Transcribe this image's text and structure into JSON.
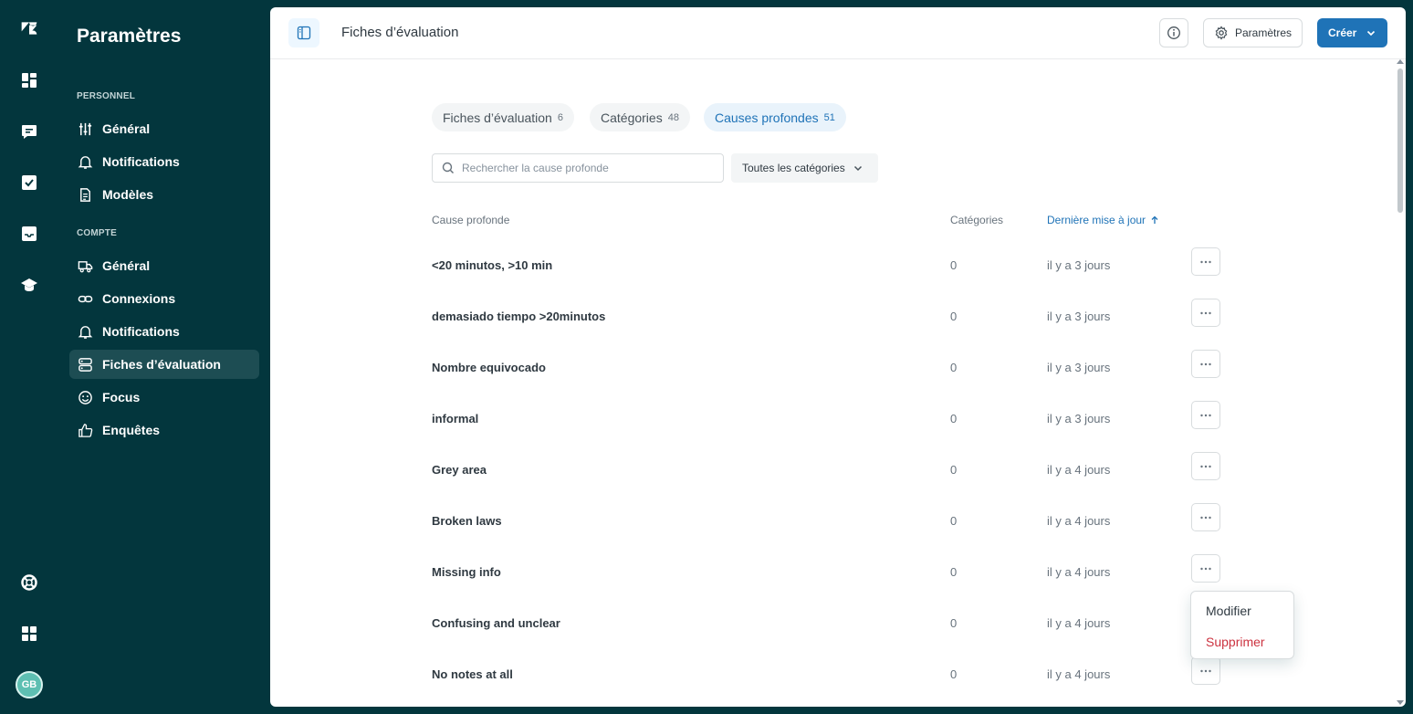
{
  "rail": {
    "icons": [
      "zendesk-logo-icon",
      "dashboard-icon",
      "conversations-icon",
      "reviews-icon",
      "inbox-icon",
      "coaching-icon",
      "help-icon",
      "apps-icon"
    ],
    "avatar_initials": "GB"
  },
  "sidebar": {
    "title": "Paramètres",
    "sections": [
      {
        "label": "PERSONNEL",
        "items": [
          {
            "label": "Général",
            "icon": "sliders-icon"
          },
          {
            "label": "Notifications",
            "icon": "bell-icon"
          },
          {
            "label": "Modèles",
            "icon": "document-icon"
          }
        ]
      },
      {
        "label": "COMPTE",
        "items": [
          {
            "label": "Général",
            "icon": "truck-icon"
          },
          {
            "label": "Connexions",
            "icon": "link-icon"
          },
          {
            "label": "Notifications",
            "icon": "bell-icon"
          },
          {
            "label": "Fiches d’évaluation",
            "icon": "scorecard-icon",
            "active": true
          },
          {
            "label": "Focus",
            "icon": "smiley-icon"
          },
          {
            "label": "Enquêtes",
            "icon": "thumbs-up-icon"
          }
        ]
      }
    ]
  },
  "header": {
    "title": "Fiches d’évaluation",
    "settings_label": "Paramètres",
    "create_label": "Créer"
  },
  "tabs": [
    {
      "label": "Fiches d’évaluation",
      "count": "6"
    },
    {
      "label": "Catégories",
      "count": "48"
    },
    {
      "label": "Causes profondes",
      "count": "51",
      "active": true
    }
  ],
  "search": {
    "placeholder": "Rechercher la cause profonde"
  },
  "filter": {
    "label": "Toutes les catégories"
  },
  "table": {
    "columns": [
      "Cause profonde",
      "Catégories",
      "Dernière mise à jour"
    ],
    "rows": [
      {
        "name": "<20 minutos, >10 min",
        "categories": "0",
        "updated": "il y a 3 jours"
      },
      {
        "name": "demasiado tiempo >20minutos",
        "categories": "0",
        "updated": "il y a 3 jours"
      },
      {
        "name": "Nombre equivocado",
        "categories": "0",
        "updated": "il y a 3 jours"
      },
      {
        "name": "informal",
        "categories": "0",
        "updated": "il y a 3 jours"
      },
      {
        "name": "Grey area",
        "categories": "0",
        "updated": "il y a 4 jours"
      },
      {
        "name": "Broken laws",
        "categories": "0",
        "updated": "il y a 4 jours"
      },
      {
        "name": "Missing info",
        "categories": "0",
        "updated": "il y a 4 jours"
      },
      {
        "name": "Confusing and unclear",
        "categories": "0",
        "updated": "il y a 4 jours"
      },
      {
        "name": "No notes at all",
        "categories": "0",
        "updated": "il y a 4 jours"
      }
    ]
  },
  "row_menu": {
    "edit_label": "Modifier",
    "delete_label": "Supprimer"
  },
  "colors": {
    "brand_dark": "#03363d",
    "accent_blue": "#1f73b7",
    "danger": "#cc3340",
    "avatar": "#5ebfb2"
  }
}
